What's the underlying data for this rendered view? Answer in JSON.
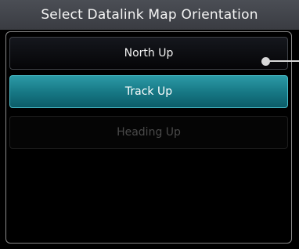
{
  "title": "Select Datalink Map Orientation",
  "options": [
    {
      "label": "North Up",
      "state": "normal"
    },
    {
      "label": "Track Up",
      "state": "selected"
    },
    {
      "label": "Heading Up",
      "state": "disabled"
    }
  ],
  "colors": {
    "selected_fill": "#167683",
    "selected_border": "#48b9c5",
    "disabled_text": "#4a4a4a",
    "title_bar": "#3a3c42"
  },
  "icons": {
    "selection_marker": "selection-pointer-icon"
  }
}
